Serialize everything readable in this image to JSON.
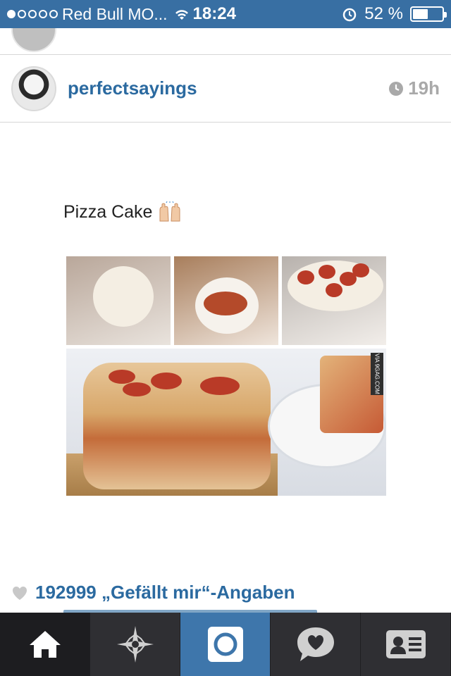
{
  "status_bar": {
    "carrier": "Red Bull MO...",
    "time": "18:24",
    "battery": "52 %",
    "battery_level": 0.52,
    "signal_bars": 1
  },
  "post": {
    "username": "perfectsayings",
    "time_ago": "19h",
    "caption": "Pizza Cake",
    "image_watermark": "VIA 9GAG.COM",
    "likes": "192999 „Gefällt mir“-Angaben"
  },
  "colors": {
    "status_bar_bg": "#386fa3",
    "link_blue": "#2b6aa0",
    "tab_bar_bg": "#2f2f33",
    "tab_active_bg": "#3e76ab"
  },
  "tab_bar": {
    "items": [
      {
        "icon": "home-icon"
      },
      {
        "icon": "explore-star-icon"
      },
      {
        "icon": "camera-icon"
      },
      {
        "icon": "activity-heart-bubble-icon"
      },
      {
        "icon": "profile-card-icon"
      }
    ]
  }
}
